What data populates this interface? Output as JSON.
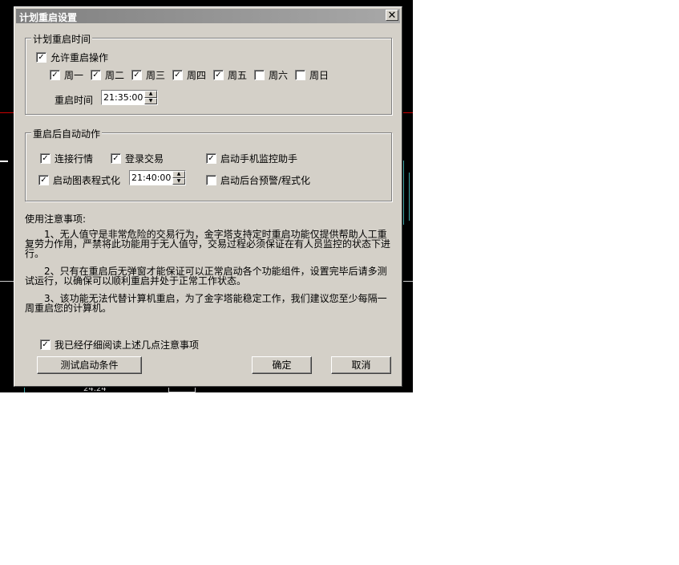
{
  "window": {
    "title": "计划重启设置",
    "close_glyph": "✕"
  },
  "schedule": {
    "group_title": "计划重启时间",
    "allow_restart": {
      "label": "允许重启操作",
      "checked": true
    },
    "days": [
      {
        "label": "周一",
        "checked": true
      },
      {
        "label": "周二",
        "checked": true
      },
      {
        "label": "周三",
        "checked": true
      },
      {
        "label": "周四",
        "checked": true
      },
      {
        "label": "周五",
        "checked": true
      },
      {
        "label": "周六",
        "checked": false
      },
      {
        "label": "周日",
        "checked": false
      }
    ],
    "restart_time_label": "重启时间",
    "restart_time_value": "21:35:00"
  },
  "auto_actions": {
    "group_title": "重启后自动动作",
    "connect_quotes": {
      "label": "连接行情",
      "checked": true
    },
    "login_trade": {
      "label": "登录交易",
      "checked": true
    },
    "mobile_assistant": {
      "label": "启动手机监控助手",
      "checked": true
    },
    "chart_program": {
      "label": "启动图表程式化",
      "checked": true
    },
    "chart_program_time": "21:40:00",
    "background_alert": {
      "label": "启动后台预警/程式化",
      "checked": false
    }
  },
  "notes": {
    "title": "使用注意事项:",
    "items": [
      "1、无人值守是非常危险的交易行为，金字塔支持定时重启功能仅提供帮助人工重复劳力作用，严禁将此功能用于无人值守，交易过程必须保证在有人员监控的状态下进行。",
      "2、只有在重启后无弹窗才能保证可以正常启动各个功能组件，设置完毕后请多测试运行，以确保可以顺利重启并处于正常工作状态。",
      "3、该功能无法代替计算机重启，为了金字塔能稳定工作，我们建议您至少每隔一周重启您的计算机。"
    ]
  },
  "acknowledge": {
    "label": "我已经仔细阅读上述几点注意事项",
    "checked": true
  },
  "buttons": {
    "test": "测试启动条件",
    "ok": "确定",
    "cancel": "取消"
  },
  "background": {
    "bottom_label": "24.24"
  }
}
